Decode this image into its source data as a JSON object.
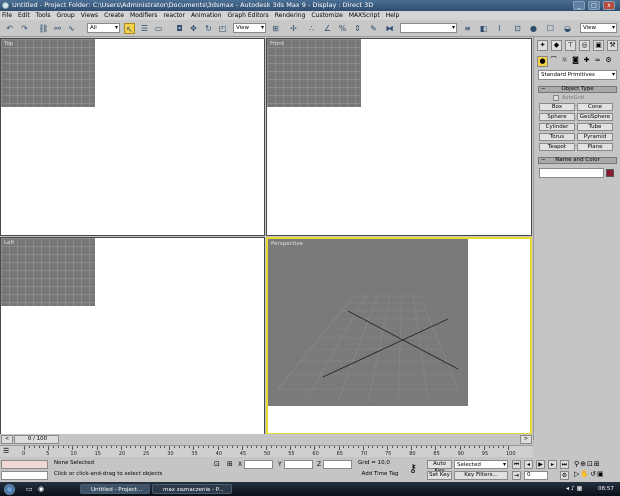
{
  "window": {
    "title": "Untitled    - Project Folder: C:\\Users\\Administrator\\Documents\\3dsmax    - Autodesk 3ds Max 9    - Display : Direct 3D",
    "minimize": "_",
    "maximize": "□",
    "close": "x"
  },
  "menu": [
    "File",
    "Edit",
    "Tools",
    "Group",
    "Views",
    "Create",
    "Modifiers",
    "reactor",
    "Animation",
    "Graph Editors",
    "Rendering",
    "Customize",
    "MAXScript",
    "Help"
  ],
  "toolbar": {
    "selection_filter": "All",
    "reference_coord": "View",
    "named_selection": "",
    "right_view": "View",
    "icons": [
      "undo-icon",
      "redo-icon",
      "select-link-icon",
      "unlink-icon",
      "bind-spacewarp-icon",
      "select-object-icon",
      "select-by-name-icon",
      "rect-region-icon",
      "window-crossing-icon",
      "select-move-icon",
      "select-rotate-icon",
      "select-scale-icon",
      "pivot-center-icon",
      "select-manipulate-icon",
      "snap-3d-icon",
      "angle-snap-icon",
      "percent-snap-icon",
      "spinner-snap-icon",
      "named-sel-icon",
      "mirror-icon",
      "align-icon",
      "layer-icon",
      "curve-editor-icon",
      "schematic-icon",
      "material-editor-icon",
      "render-scene-icon",
      "quick-render-icon"
    ]
  },
  "viewports": {
    "top": "Top",
    "front": "Front",
    "left": "Left",
    "perspective": "Perspective"
  },
  "command_panel": {
    "category": "Standard Primitives",
    "object_type_title": "Object Type",
    "autogrid": "AutoGrid",
    "buttons": [
      "Box",
      "Cone",
      "Sphere",
      "GeoSphere",
      "Cylinder",
      "Tube",
      "Torus",
      "Pyramid",
      "Teapot",
      "Plane"
    ],
    "name_color_title": "Name and Color",
    "object_color": "#8b1a2e"
  },
  "timeline": {
    "frame": "0 / 100",
    "ticks": [
      "0",
      "5",
      "10",
      "15",
      "20",
      "25",
      "30",
      "35",
      "40",
      "45",
      "50",
      "55",
      "60",
      "65",
      "70",
      "75",
      "80",
      "85",
      "90",
      "95",
      "100"
    ]
  },
  "status": {
    "selection": "None Selected",
    "prompt": "Click or click-and-drag to select objects",
    "x_label": "X",
    "y_label": "Y",
    "z_label": "Z",
    "grid": "Grid = 10,0",
    "add_time_tag": "Add Time Tag",
    "auto_key": "Auto Key",
    "set_key": "Set Key",
    "key_mode": "Selected",
    "key_filters": "Key Filters...",
    "current_frame": "0"
  },
  "taskbar": {
    "tasks": [
      "Untitled    - Project...",
      "max zaznaczenie - P..."
    ],
    "clock": "08:57"
  }
}
